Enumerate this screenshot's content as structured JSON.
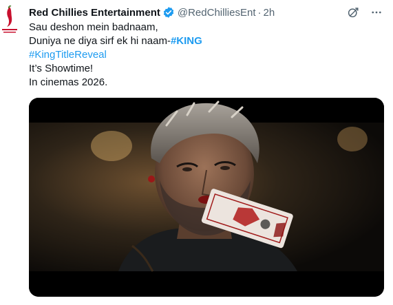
{
  "tweet": {
    "display_name": "Red Chillies Entertainment",
    "handle": "@RedChilliesEnt",
    "separator": "·",
    "time": "2h",
    "verified_icon": "verified-badge-icon",
    "avatar_icon": "red-chillies-logo",
    "lines": [
      {
        "text": "Sau deshon mein badnaam,"
      },
      {
        "text": "Duniya ne diya sirf ek hi naam-",
        "hashtag": "#KING"
      },
      {
        "hashtag": "#KingTitleReveal"
      },
      {
        "text": "It’s Showtime!"
      },
      {
        "text": "In cinemas 2026."
      }
    ],
    "top_actions": {
      "grok_icon": "grok-icon",
      "more_icon": "more-dots-icon"
    },
    "media": {
      "kind": "video-still",
      "description_icon": "video-frame"
    }
  },
  "colors": {
    "text": "#0f1419",
    "secondary": "#536471",
    "link": "#1d9bf0",
    "verified": "#1d9bf0",
    "brand_red": "#c8102e"
  }
}
